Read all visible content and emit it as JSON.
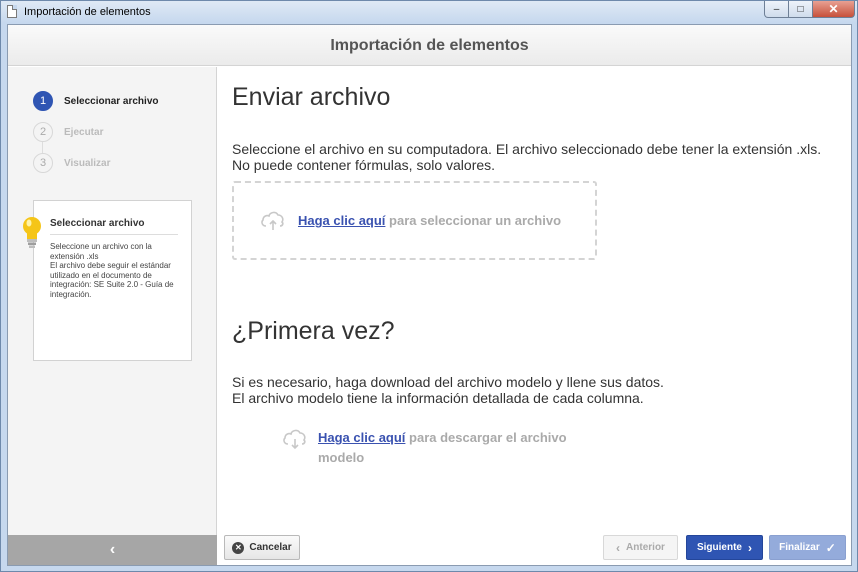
{
  "window": {
    "title": "Importación de elementos",
    "controls": {
      "minimize": "–",
      "maximize": "□",
      "close": "✕"
    }
  },
  "header": {
    "title": "Importación de elementos"
  },
  "steps": [
    {
      "number": "1",
      "label": "Seleccionar archivo",
      "active": true
    },
    {
      "number": "2",
      "label": "Ejecutar",
      "active": false
    },
    {
      "number": "3",
      "label": "Visualizar",
      "active": false
    }
  ],
  "help": {
    "title": "Seleccionar archivo",
    "lines": [
      "Seleccione un archivo con la extensión .xls",
      "El archivo debe seguir el estándar utilizado en el documento de integración: SE Suite 2.0 - Guía de integración."
    ],
    "icon": "lightbulb-icon"
  },
  "sidebar": {
    "collapse_glyph": "‹"
  },
  "upload": {
    "heading": "Enviar archivo",
    "description_line1": "Seleccione el archivo en su computadora. El archivo seleccionado debe tener la extensión .xls.",
    "description_line2": "No puede contener fórmulas, solo valores.",
    "link_text": "Haga clic aquí",
    "link_suffix": "para seleccionar un archivo"
  },
  "first_time": {
    "heading": "¿Primera vez?",
    "description_line1": "Si es necesario, haga download del archivo modelo y llene sus datos.",
    "description_line2": "El archivo modelo tiene la información detallada de cada columna.",
    "link_text": "Haga clic aquí",
    "link_suffix": "para descargar el archivo modelo"
  },
  "footer": {
    "cancel": "Cancelar",
    "previous": "Anterior",
    "next": "Siguiente",
    "finish": "Finalizar"
  },
  "colors": {
    "accent": "#2f55b3",
    "link": "#3a52b0",
    "disabled_text": "#aaaaaa",
    "finish_disabled": "#94abdb",
    "bulb": "#f5c518"
  }
}
